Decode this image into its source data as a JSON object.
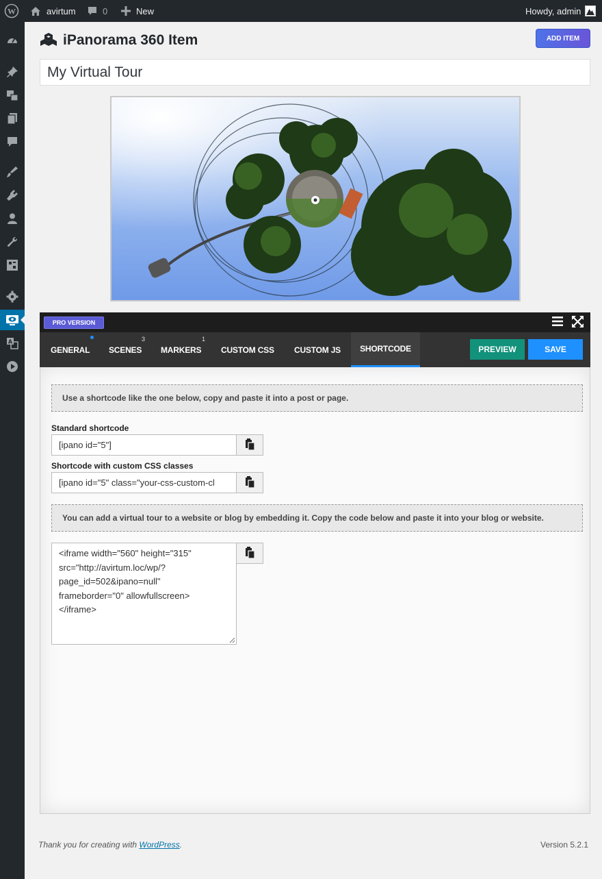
{
  "adminbar": {
    "site_name": "avirtum",
    "comments_count": "0",
    "new_label": "New",
    "greeting": "Howdy, admin"
  },
  "header": {
    "title": "iPanorama 360 Item",
    "add_item_label": "ADD ITEM"
  },
  "item": {
    "title_value": "My Virtual Tour"
  },
  "editor": {
    "pro_badge": "PRO VERSION",
    "tabs": [
      {
        "label": "GENERAL",
        "count": ""
      },
      {
        "label": "SCENES",
        "count": "3"
      },
      {
        "label": "MARKERS",
        "count": "1"
      },
      {
        "label": "CUSTOM CSS",
        "count": ""
      },
      {
        "label": "CUSTOM JS",
        "count": ""
      },
      {
        "label": "SHORTCODE",
        "count": ""
      }
    ],
    "active_tab": "SHORTCODE",
    "preview_label": "PREVIEW",
    "save_label": "SAVE"
  },
  "shortcode": {
    "notice1": "Use a shortcode like the one below, copy and paste it into a post or page.",
    "standard_label": "Standard shortcode",
    "standard_value": "[ipano id=\"5\"]",
    "custom_label": "Shortcode with custom CSS classes",
    "custom_value": "[ipano id=\"5\" class=\"your-css-custom-cl",
    "notice2": "You can add a virtual tour to a website or blog by embedding it. Copy the code below and paste it into your blog or website.",
    "embed_code": "<iframe width=\"560\" height=\"315\"\nsrc=\"http://avirtum.loc/wp/?\npage_id=502&ipano=null\"\nframeborder=\"0\" allowfullscreen>\n</iframe>"
  },
  "footer": {
    "thanks_text": "Thank you for creating with ",
    "wp_link": "WordPress",
    "period": ".",
    "version": "Version 5.2.1"
  },
  "colors": {
    "adminbar_bg": "#23282d",
    "accent_blue": "#1e90ff",
    "preview_green": "#12917b",
    "pro_purple": "#5b5bd6"
  }
}
